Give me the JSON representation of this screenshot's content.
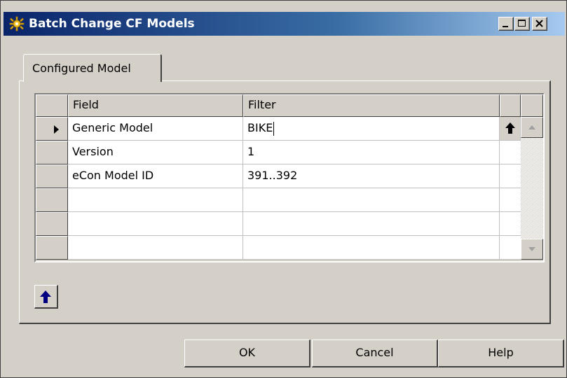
{
  "window": {
    "title": "Batch Change CF Models"
  },
  "tabs": [
    {
      "label": "Configured Model"
    }
  ],
  "grid": {
    "columns": [
      "Field",
      "Filter"
    ],
    "rows": [
      {
        "field": "Generic Model",
        "filter": "BIKE",
        "current": true
      },
      {
        "field": "Version",
        "filter": "1"
      },
      {
        "field": "eCon Model ID",
        "filter": "391..392"
      },
      {
        "field": "",
        "filter": ""
      },
      {
        "field": "",
        "filter": ""
      },
      {
        "field": "",
        "filter": ""
      }
    ]
  },
  "buttons": {
    "ok": "OK",
    "cancel": "Cancel",
    "help": "Help"
  },
  "icons": {
    "app": "gear-sun-icon",
    "row_pointer": "triangle-right-icon",
    "lookup": "up-arrow-icon",
    "up": "up-arrow-icon"
  },
  "colors": {
    "title_start": "#0a246a",
    "title_end": "#a6caf0",
    "face": "#d4d0c8",
    "icon_blue": "#000080"
  }
}
